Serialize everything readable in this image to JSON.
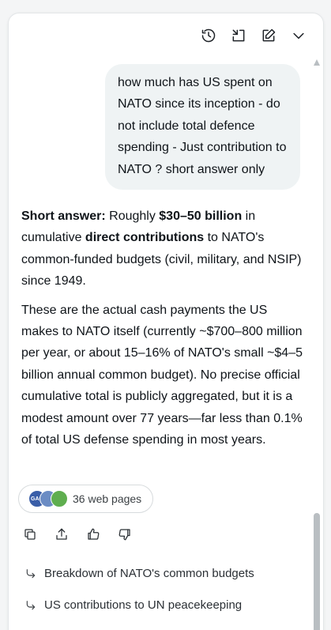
{
  "header": {
    "icons": [
      "history-icon",
      "collapse-icon",
      "new-chat-icon",
      "chevron-down-icon"
    ]
  },
  "user_message": "how much has US spent on NATO since its inception - do not include total defence spending - Just contribution to NATO  ? short answer only",
  "answer": {
    "p1": {
      "lead": "Short answer:",
      "t1": " Roughly ",
      "amount": "$30–50 billion",
      "t2": " in cumulative ",
      "emph": "direct contributions",
      "t3": " to NATO's common-funded budgets (civil, military, and NSIP) since 1949."
    },
    "p2": "These are the actual cash payments the US makes to NATO itself (currently ~$700–800 million per year, or about 15–16% of NATO's small ~$4–5 billion annual common budget). No precise official cumulative total is publicly aggregated, but it is a modest amount over 77 years—far less than 0.1% of total US defense spending in most years."
  },
  "sources": {
    "label": "36 web pages",
    "favicon_text": "GAO",
    "colors": [
      "#3a5ea8",
      "#6b8cc4",
      "#5fae4f"
    ]
  },
  "actions": [
    "copy-icon",
    "share-icon",
    "thumbs-up-icon",
    "thumbs-down-icon"
  ],
  "suggestions": [
    "Breakdown of NATO's common budgets",
    "US contributions to UN peacekeeping"
  ]
}
